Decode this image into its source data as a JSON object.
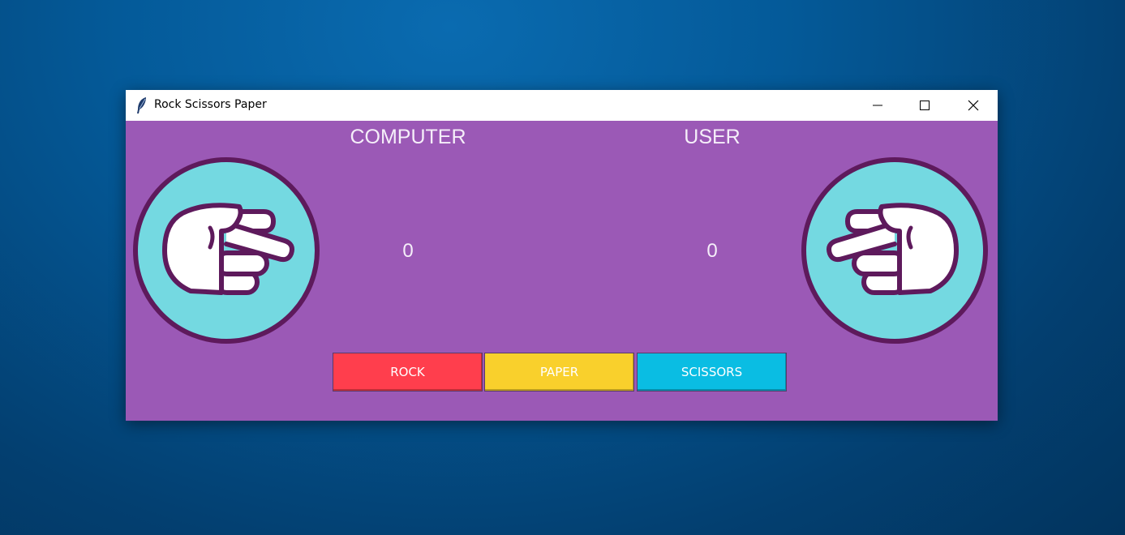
{
  "window": {
    "title": "Rock Scissors Paper",
    "controls": {
      "minimize": "minimize-icon",
      "maximize": "maximize-icon",
      "close": "close-icon"
    }
  },
  "labels": {
    "computer": "COMPUTER",
    "user": "USER"
  },
  "scores": {
    "computer": "0",
    "user": "0"
  },
  "hands": {
    "computer": "scissors-hand-icon",
    "user": "scissors-hand-icon"
  },
  "buttons": {
    "rock": "ROCK",
    "paper": "PAPER",
    "scissors": "SCISSORS"
  },
  "colors": {
    "background": "#9b59b6",
    "rock": "#ff3e4d",
    "paper": "#f9d02c",
    "scissors": "#0abde3",
    "circle_fill": "#74d9e1",
    "circle_outline": "#5e1a5c"
  }
}
